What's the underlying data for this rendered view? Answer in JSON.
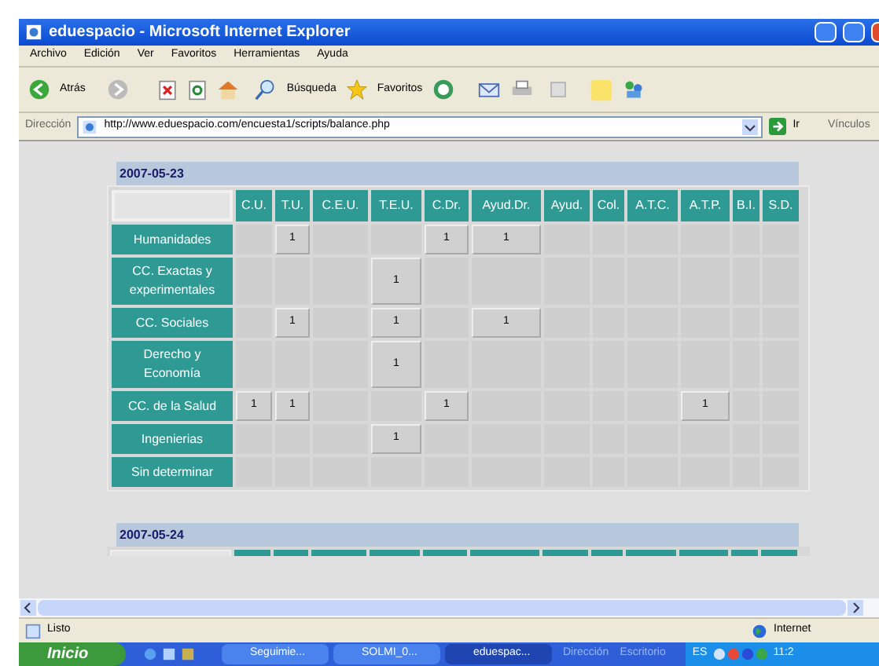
{
  "window": {
    "title": "eduespacio - Microsoft Internet Explorer"
  },
  "menu": [
    "Archivo",
    "Edición",
    "Ver",
    "Favoritos",
    "Herramientas",
    "Ayuda"
  ],
  "toolbar": {
    "back": "Atrás",
    "search": "Búsqueda",
    "favorites": "Favoritos"
  },
  "address": {
    "label": "Dirección",
    "value": "http://www.eduespacio.com/encuesta1/scripts/balance.php",
    "go": "Ir",
    "links": "Vínculos"
  },
  "table": {
    "date": "2007-05-23",
    "columns": [
      "C.U.",
      "T.U.",
      "C.E.U.",
      "T.E.U.",
      "C.Dr.",
      "Ayud.Dr.",
      "Ayud.",
      "Col.",
      "A.T.C.",
      "A.T.P.",
      "B.I.",
      "S.D."
    ],
    "rows": [
      {
        "label": "Humanidades",
        "cells": [
          null,
          "1",
          null,
          null,
          "1",
          "1",
          null,
          null,
          null,
          null,
          null,
          null
        ]
      },
      {
        "label": "CC. Exactas y experimentales",
        "cells": [
          null,
          null,
          null,
          "1",
          null,
          null,
          null,
          null,
          null,
          null,
          null,
          null
        ]
      },
      {
        "label": "CC. Sociales",
        "cells": [
          null,
          "1",
          null,
          "1",
          null,
          "1",
          null,
          null,
          null,
          null,
          null,
          null
        ]
      },
      {
        "label": "Derecho y Economía",
        "cells": [
          null,
          null,
          null,
          "1",
          null,
          null,
          null,
          null,
          null,
          null,
          null,
          null
        ]
      },
      {
        "label": "CC. de la Salud",
        "cells": [
          "1",
          "1",
          null,
          null,
          "1",
          null,
          null,
          null,
          null,
          "1",
          null,
          null
        ]
      },
      {
        "label": "Ingenierias",
        "cells": [
          null,
          null,
          null,
          "1",
          null,
          null,
          null,
          null,
          null,
          null,
          null,
          null
        ]
      },
      {
        "label": "Sin determinar",
        "cells": [
          null,
          null,
          null,
          null,
          null,
          null,
          null,
          null,
          null,
          null,
          null,
          null
        ]
      }
    ]
  },
  "next_table": {
    "date": "2007-05-24"
  },
  "status_bar": {
    "text": "Listo",
    "zone": "Internet"
  },
  "taskbar": {
    "start": "Inicio",
    "tasks": [
      {
        "label": "Seguimie...",
        "selected": false
      },
      {
        "label": "SOLMI_0...",
        "selected": false
      },
      {
        "label": "eduespac...",
        "selected": true
      }
    ],
    "toolbars": [
      "Dirección",
      "Escritorio"
    ],
    "language": "ES",
    "clock": "11:2"
  }
}
